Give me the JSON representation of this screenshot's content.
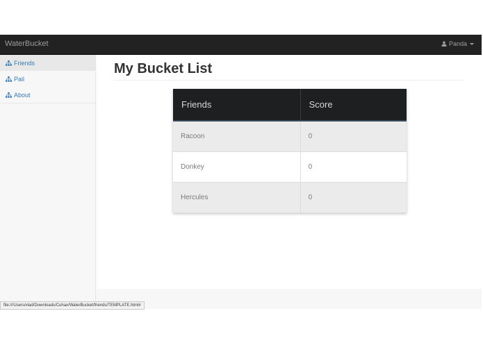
{
  "navbar": {
    "brand": "WaterBucket",
    "user": "Panda"
  },
  "sidebar": {
    "items": [
      {
        "label": "Friends",
        "icon": "sitemap-icon",
        "active": true
      },
      {
        "label": "Pail",
        "icon": "sitemap-icon",
        "active": false
      },
      {
        "label": "About",
        "icon": "sitemap-icon",
        "active": false
      }
    ]
  },
  "main": {
    "title": "My Bucket List",
    "table": {
      "headers": [
        "Friends",
        "Score"
      ],
      "rows": [
        {
          "name": "Racoon",
          "score": "0"
        },
        {
          "name": "Donkey",
          "score": "0"
        },
        {
          "name": "Hercules",
          "score": "0"
        }
      ]
    }
  },
  "status_bar": {
    "url": "file:///Users/vlad/Downloads/Cuhax/WaterBucket/friends/TEMPLATE.html#"
  },
  "colors": {
    "navbar_bg": "#222222",
    "link": "#337ab7",
    "table_header_bg": "#1d1f20"
  }
}
